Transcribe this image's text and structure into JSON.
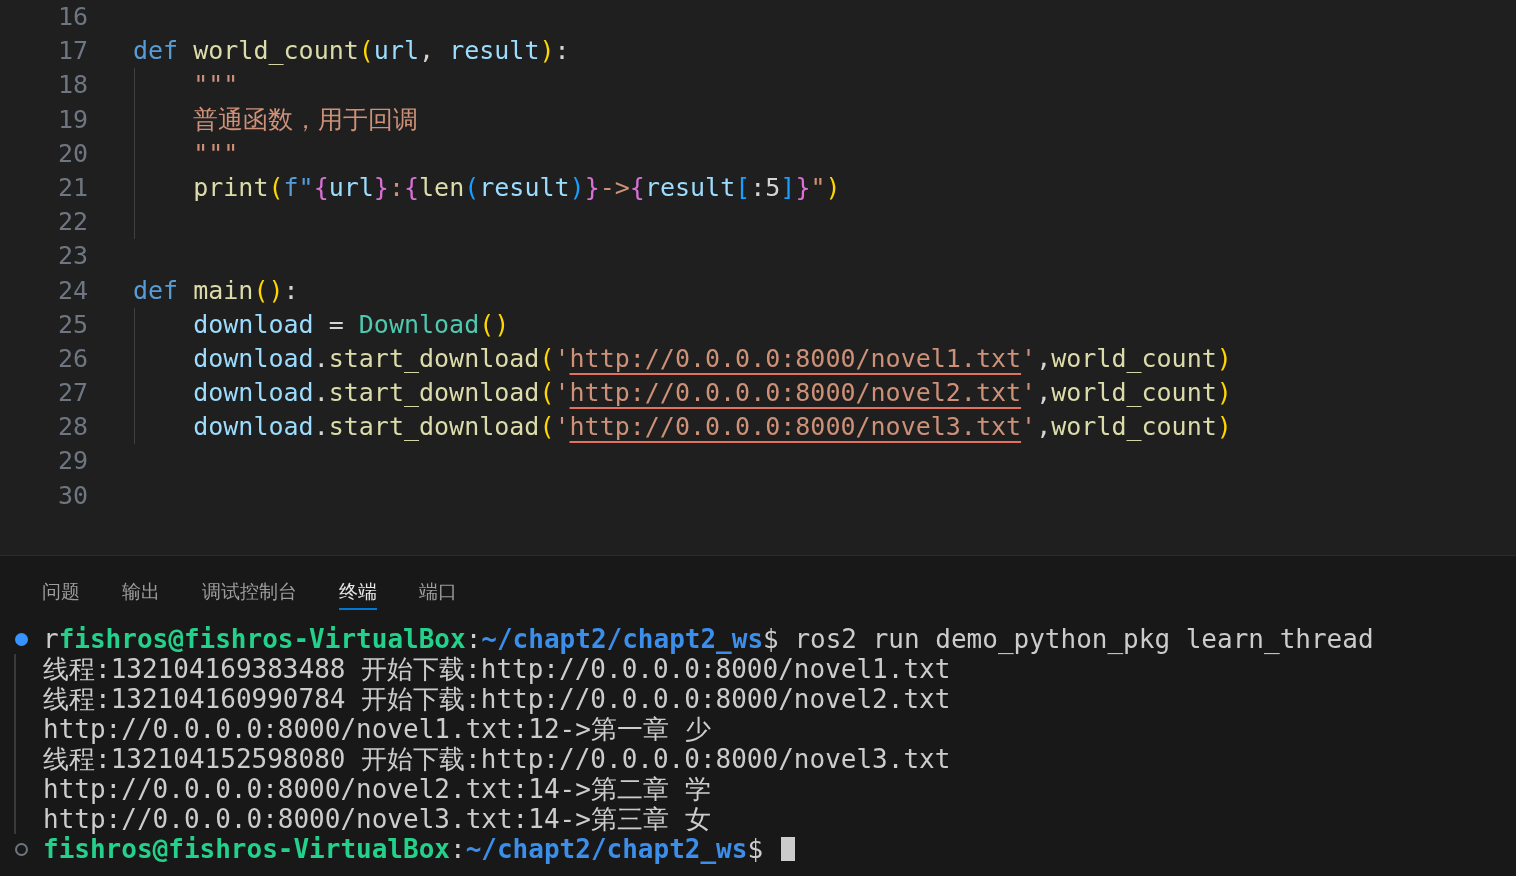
{
  "editor": {
    "lines": [
      {
        "number": "16",
        "indent_guide": false
      },
      {
        "number": "17",
        "indent_guide": false,
        "tokens": [
          {
            "text": "def ",
            "kind": "keyword"
          },
          {
            "text": "world_count",
            "kind": "function"
          },
          {
            "text": "(",
            "kind": "bracket1"
          },
          {
            "text": "url",
            "kind": "param"
          },
          {
            "text": ", ",
            "kind": "plain"
          },
          {
            "text": "result",
            "kind": "param"
          },
          {
            "text": ")",
            "kind": "bracket1"
          },
          {
            "text": ":",
            "kind": "plain"
          }
        ]
      },
      {
        "number": "18",
        "indent_guide": true,
        "tokens": [
          {
            "text": "    \"\"\"",
            "kind": "string"
          }
        ]
      },
      {
        "number": "19",
        "indent_guide": true,
        "tokens": [
          {
            "text": "    普通函数，用于回调",
            "kind": "string"
          }
        ]
      },
      {
        "number": "20",
        "indent_guide": true,
        "tokens": [
          {
            "text": "    \"\"\"",
            "kind": "string"
          }
        ]
      },
      {
        "number": "21",
        "indent_guide": true,
        "tokens": [
          {
            "text": "    print",
            "kind": "function"
          },
          {
            "text": "(",
            "kind": "bracket1"
          },
          {
            "text": "f\"",
            "kind": "keyword"
          },
          {
            "text": "{",
            "kind": "bracket2"
          },
          {
            "text": "url",
            "kind": "param"
          },
          {
            "text": "}",
            "kind": "bracket2"
          },
          {
            "text": ":",
            "kind": "string"
          },
          {
            "text": "{",
            "kind": "bracket2"
          },
          {
            "text": "len",
            "kind": "function"
          },
          {
            "text": "(",
            "kind": "bracket3"
          },
          {
            "text": "result",
            "kind": "param"
          },
          {
            "text": ")",
            "kind": "bracket3"
          },
          {
            "text": "}",
            "kind": "bracket2"
          },
          {
            "text": "->",
            "kind": "string"
          },
          {
            "text": "{",
            "kind": "bracket2"
          },
          {
            "text": "result",
            "kind": "param"
          },
          {
            "text": "[",
            "kind": "bracket3"
          },
          {
            "text": ":5",
            "kind": "plain"
          },
          {
            "text": "]",
            "kind": "bracket3"
          },
          {
            "text": "}",
            "kind": "bracket2"
          },
          {
            "text": "\"",
            "kind": "string"
          },
          {
            "text": ")",
            "kind": "bracket1"
          }
        ]
      },
      {
        "number": "22",
        "indent_guide": true
      },
      {
        "number": "23",
        "indent_guide": false
      },
      {
        "number": "24",
        "indent_guide": false,
        "tokens": [
          {
            "text": "def ",
            "kind": "keyword"
          },
          {
            "text": "main",
            "kind": "function"
          },
          {
            "text": "()",
            "kind": "bracket1"
          },
          {
            "text": ":",
            "kind": "plain"
          }
        ]
      },
      {
        "number": "25",
        "indent_guide": true,
        "tokens": [
          {
            "text": "    download",
            "kind": "param"
          },
          {
            "text": " = ",
            "kind": "plain"
          },
          {
            "text": "Download",
            "kind": "class"
          },
          {
            "text": "()",
            "kind": "bracket1"
          }
        ]
      },
      {
        "number": "26",
        "indent_guide": true,
        "tokens": [
          {
            "text": "    download",
            "kind": "param"
          },
          {
            "text": ".",
            "kind": "plain"
          },
          {
            "text": "start_download",
            "kind": "function"
          },
          {
            "text": "(",
            "kind": "bracket1"
          },
          {
            "text": "'",
            "kind": "string"
          },
          {
            "text": "http://0.0.0.0:8000/novel1.txt",
            "kind": "link"
          },
          {
            "text": "'",
            "kind": "string"
          },
          {
            "text": ",",
            "kind": "plain"
          },
          {
            "text": "world_count",
            "kind": "function"
          },
          {
            "text": ")",
            "kind": "bracket1"
          }
        ]
      },
      {
        "number": "27",
        "indent_guide": true,
        "tokens": [
          {
            "text": "    download",
            "kind": "param"
          },
          {
            "text": ".",
            "kind": "plain"
          },
          {
            "text": "start_download",
            "kind": "function"
          },
          {
            "text": "(",
            "kind": "bracket1"
          },
          {
            "text": "'",
            "kind": "string"
          },
          {
            "text": "http://0.0.0.0:8000/novel2.txt",
            "kind": "link"
          },
          {
            "text": "'",
            "kind": "string"
          },
          {
            "text": ",",
            "kind": "plain"
          },
          {
            "text": "world_count",
            "kind": "function"
          },
          {
            "text": ")",
            "kind": "bracket1"
          }
        ]
      },
      {
        "number": "28",
        "indent_guide": true,
        "tokens": [
          {
            "text": "    download",
            "kind": "param"
          },
          {
            "text": ".",
            "kind": "plain"
          },
          {
            "text": "start_download",
            "kind": "function"
          },
          {
            "text": "(",
            "kind": "bracket1"
          },
          {
            "text": "'",
            "kind": "string"
          },
          {
            "text": "http://0.0.0.0:8000/novel3.txt",
            "kind": "link"
          },
          {
            "text": "'",
            "kind": "string"
          },
          {
            "text": ",",
            "kind": "plain"
          },
          {
            "text": "world_count",
            "kind": "function"
          },
          {
            "text": ")",
            "kind": "bracket1"
          }
        ]
      },
      {
        "number": "29",
        "indent_guide": false
      },
      {
        "number": "30",
        "indent_guide": false
      }
    ]
  },
  "panel": {
    "tabs": [
      {
        "label": "问题",
        "selected": false
      },
      {
        "label": "输出",
        "selected": false
      },
      {
        "label": "调试控制台",
        "selected": false
      },
      {
        "label": "终端",
        "selected": true
      },
      {
        "label": "端口",
        "selected": false
      }
    ]
  },
  "terminal": {
    "lines": [
      {
        "kind": "prompt",
        "done": true,
        "tokens": [
          {
            "text": "r",
            "kind": "plain"
          },
          {
            "text": "fishros@fishros-VirtualBox",
            "kind": "user"
          },
          {
            "text": ":",
            "kind": "plain"
          },
          {
            "text": "~/chapt2/chapt2_ws",
            "kind": "path"
          },
          {
            "text": "$ ros2 run demo_python_pkg learn_thread",
            "kind": "plain"
          }
        ]
      },
      {
        "kind": "output",
        "tokens": [
          {
            "text": "线程:132104169383488 开始下载:http://0.0.0.0:8000/novel1.txt",
            "kind": "plain"
          }
        ]
      },
      {
        "kind": "output",
        "tokens": [
          {
            "text": "线程:132104160990784 开始下载:http://0.0.0.0:8000/novel2.txt",
            "kind": "plain"
          }
        ]
      },
      {
        "kind": "output",
        "tokens": [
          {
            "text": "http://0.0.0.0:8000/novel1.txt:12->第一章 少",
            "kind": "plain"
          }
        ]
      },
      {
        "kind": "output",
        "tokens": [
          {
            "text": "线程:132104152598080 开始下载:http://0.0.0.0:8000/novel3.txt",
            "kind": "plain"
          }
        ]
      },
      {
        "kind": "output",
        "tokens": [
          {
            "text": "http://0.0.0.0:8000/novel2.txt:14->第二章 学",
            "kind": "plain"
          }
        ]
      },
      {
        "kind": "output",
        "tokens": [
          {
            "text": "http://0.0.0.0:8000/novel3.txt:14->第三章 女",
            "kind": "plain"
          }
        ]
      },
      {
        "kind": "prompt",
        "done": false,
        "tokens": [
          {
            "text": "fishros@fishros-VirtualBox",
            "kind": "user"
          },
          {
            "text": ":",
            "kind": "plain"
          },
          {
            "text": "~/chapt2/chapt2_ws",
            "kind": "path"
          },
          {
            "text": "$ ",
            "kind": "plain"
          }
        ]
      }
    ]
  }
}
